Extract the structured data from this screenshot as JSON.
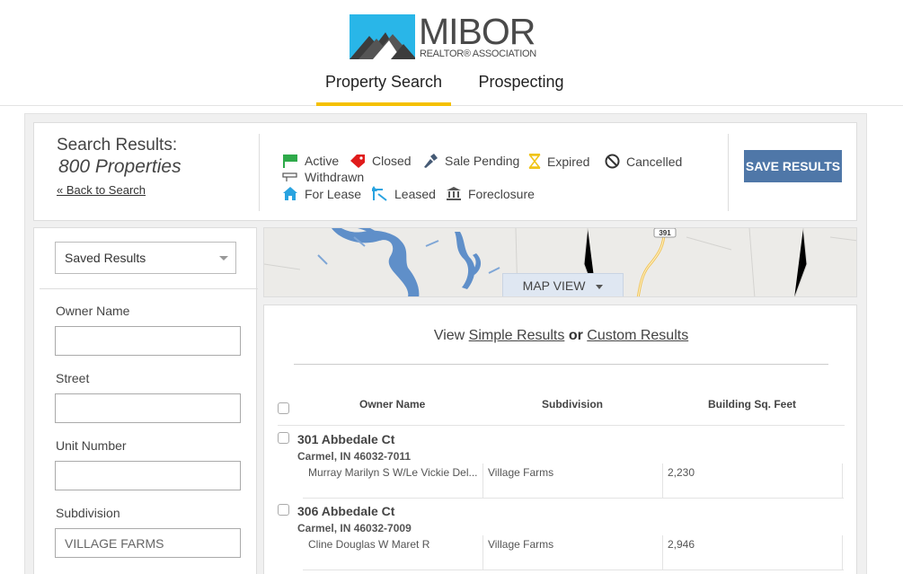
{
  "brand": {
    "name": "MIBOR",
    "subtitle": "REALTOR® ASSOCIATION",
    "colors": {
      "accent": "#f5c000",
      "button": "#4f77a8",
      "logo_blue": "#29b6e8",
      "logo_gray": "#4a4a4a"
    }
  },
  "nav": {
    "tabs": [
      {
        "label": "Property Search",
        "active": true
      },
      {
        "label": "Prospecting",
        "active": false
      }
    ]
  },
  "summary": {
    "title": "Search Results:",
    "count": "800 Properties",
    "back_link": "« Back to Search",
    "save_button": "SAVE RESULTS",
    "legend": [
      {
        "label": "Active",
        "icon": "flag-icon",
        "color": "#2eaa4a"
      },
      {
        "label": "Closed",
        "icon": "price-tag-icon",
        "color": "#e01b1b"
      },
      {
        "label": "Sale Pending",
        "icon": "gavel-icon",
        "color": "#455a75"
      },
      {
        "label": "Expired",
        "icon": "hourglass-icon",
        "color": "#f0c419"
      },
      {
        "label": "Cancelled",
        "icon": "ban-icon",
        "color": "#333333"
      },
      {
        "label": "Withdrawn",
        "icon": "withdrawn-icon",
        "color": "#555555"
      },
      {
        "label": "For Lease",
        "icon": "house-icon",
        "color": "#29a3e0"
      },
      {
        "label": "Leased",
        "icon": "leased-arrow-icon",
        "color": "#29a3e0"
      },
      {
        "label": "Foreclosure",
        "icon": "bank-icon",
        "color": "#555555"
      }
    ]
  },
  "filters": {
    "saved_select": "Saved Results",
    "fields": [
      {
        "label": "Owner Name",
        "value": "",
        "placeholder": ""
      },
      {
        "label": "Street",
        "value": "",
        "placeholder": ""
      },
      {
        "label": "Unit Number",
        "value": "",
        "placeholder": ""
      },
      {
        "label": "Subdivision",
        "value": "",
        "placeholder": "VILLAGE FARMS"
      }
    ]
  },
  "map": {
    "toggle_label": "MAP VIEW",
    "road_marker": "391"
  },
  "results": {
    "view_prefix": "View",
    "simple_link": "Simple Results",
    "or_word": "or",
    "custom_link": "Custom Results",
    "columns": [
      "Owner Name",
      "Subdivision",
      "Building Sq. Feet"
    ],
    "rows": [
      {
        "address": "301 Abbedale Ct",
        "city": "Carmel, IN 46032-7011",
        "owner": "Murray Marilyn S W/Le Vickie Del...",
        "subdivision": "Village Farms",
        "sqft": "2,230"
      },
      {
        "address": "306 Abbedale Ct",
        "city": "Carmel, IN 46032-7009",
        "owner": "Cline Douglas W Maret R",
        "subdivision": "Village Farms",
        "sqft": "2,946"
      }
    ]
  }
}
